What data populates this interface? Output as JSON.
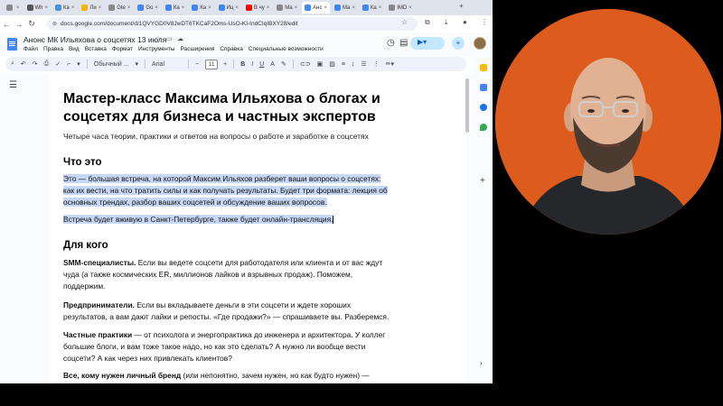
{
  "browser": {
    "tabs": [
      {
        "label": "",
        "color": "#888888"
      },
      {
        "label": "Wh",
        "color": "#555555"
      },
      {
        "label": "Ка",
        "color": "#4a90d9"
      },
      {
        "label": "Ли",
        "color": "#f4b400"
      },
      {
        "label": "Gte",
        "color": "#888888"
      },
      {
        "label": "Go",
        "color": "#4285f4"
      },
      {
        "label": "Ка",
        "color": "#4285f4"
      },
      {
        "label": "Ка",
        "color": "#4285f4"
      },
      {
        "label": "Иц",
        "color": "#4285f4"
      },
      {
        "label": "В чу",
        "color": "#ff0000"
      },
      {
        "label": "Ма",
        "color": "#888888"
      },
      {
        "label": "Анс",
        "color": "#4285f4",
        "active": true
      },
      {
        "label": "Ма",
        "color": "#4285f4"
      },
      {
        "label": "Ка",
        "color": "#4285f4"
      },
      {
        "label": "IMD",
        "color": "#888888"
      }
    ],
    "url": "docs.google.com/document/d/1QVYGD0V8JwDT6TKCaF2Oms-UsO-KI-IndCIqIBXY28/edit"
  },
  "docs": {
    "title": "Анонс МК Ильяхова о соцсетях 13 июля",
    "menu": [
      "Файл",
      "Правка",
      "Вид",
      "Вставка",
      "Формат",
      "Инструменты",
      "Расширения",
      "Справка",
      "Специальные возможности"
    ],
    "toolbar": {
      "style": "Обычный ...",
      "font": "Arial",
      "size": "11"
    }
  },
  "document": {
    "heading": "Мастер-класс Максима Ильяхова о блогах и соцсетях для бизнеса и частных экспертов",
    "subtitle": "Четыре часа теории, практики и ответов на вопросы о работе и заработке в соцсетях",
    "section1": "Что это",
    "p1_line1": "Это — большая встреча, на которой Максим Ильяхов разберет ваши вопросы о соцсетях:",
    "p1_line2": "как их вести, на что тратить силы и как получать результаты. Будет три формата: лекция об",
    "p1_line3": "основных трендах, разбор ваших соцсетей и обсуждение ваших вопросов.",
    "p2": "Встреча будет вживую в Санкт-Петербурге, также будет онлайн-трансляция.",
    "section2": "Для кого",
    "smm_bold": "SMM-специалисты.",
    "smm_text_1": " Если вы ведете соцсети для работодателя или клиента и от вас ждут",
    "smm_text_2": "чуда (а также космических ER, миллионов лайков и взрывных продаж). Поможем,",
    "smm_text_3": "поддержим.",
    "ent_bold": "Предприниматели.",
    "ent_text_1": " Если вы вкладываете деньги в эти соцсети и ждете хороших",
    "ent_text_2": "результатов, а вам дают лайки и репосты. «Где продажи?» — спрашиваете вы. Разберемся.",
    "prac_bold": "Частные практики",
    "prac_text_1": " — от психолога и энергопрактика до инженера и архитектора. У коллег",
    "prac_text_2": "большие блоги, и вам тоже такое надо, но как это сделать? А нужно ли вообще вести",
    "prac_text_3": "соцсети? А как через них привлекать клиентов?",
    "brand_bold": "Все, кому нужен личный бренд",
    "brand_text": " (или непонятно, зачем нужен, но как будто нужен) —"
  },
  "colors": {
    "highlight": "#c6d8f5",
    "cam_background": "#dd5b1c",
    "docs_blue": "#4285f4"
  }
}
